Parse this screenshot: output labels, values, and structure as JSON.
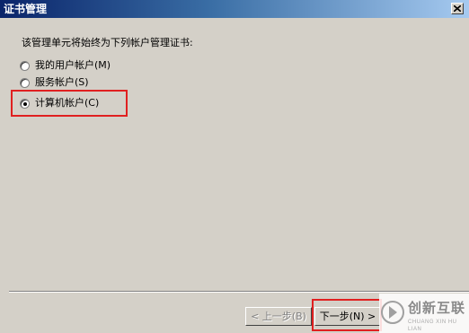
{
  "window": {
    "title": "证书管理",
    "close_icon": "close-icon"
  },
  "instruction": "该管理单元将始终为下列帐户管理证书:",
  "options": [
    {
      "label": "我的用户帐户(M)",
      "selected": false
    },
    {
      "label": "服务帐户(S)",
      "selected": false
    },
    {
      "label": "计算机帐户(C)",
      "selected": true
    }
  ],
  "buttons": {
    "back_label": "< 上一步(B)",
    "next_label": "下一步(N) >"
  },
  "watermark": {
    "brand": "创新互联",
    "subtitle": "CHUANG XIN HU LIAN"
  },
  "colors": {
    "highlight": "#e02020",
    "titlebar": "#0a246a",
    "dialog_bg": "#d4d0c8"
  }
}
